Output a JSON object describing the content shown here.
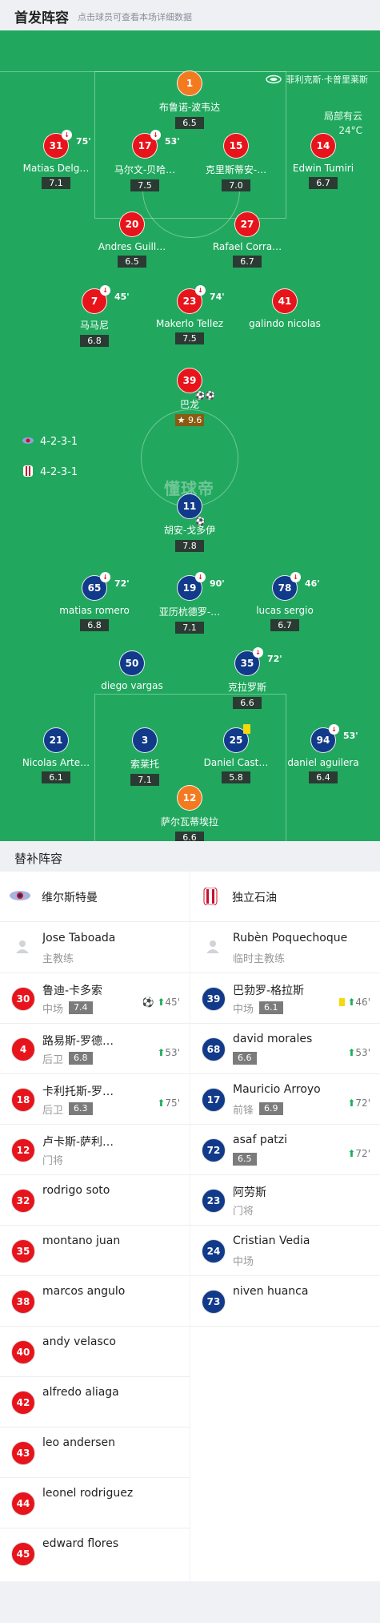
{
  "header": {
    "title": "首发阵容",
    "subtitle": "点击球员可查看本场详细数据"
  },
  "pitch": {
    "venue": "菲利克斯·卡普里莱斯",
    "weather": "局部有云",
    "temperature": "24°C",
    "watermark": "懂球帝",
    "home_formation": "4-2-3-1",
    "away_formation": "4-2-3-1",
    "home_players": [
      {
        "number": "1",
        "name": "布鲁诺-波韦达",
        "rating": "6.5"
      },
      {
        "number": "31",
        "name": "Matias Delg…",
        "rating": "7.1",
        "sub_min": "75'"
      },
      {
        "number": "17",
        "name": "马尔文-贝哈…",
        "rating": "7.5",
        "sub_min": "53'"
      },
      {
        "number": "15",
        "name": "克里斯蒂安-…",
        "rating": "7.0"
      },
      {
        "number": "14",
        "name": "Edwin Tumiri",
        "rating": "6.7"
      },
      {
        "number": "20",
        "name": "Andres Guill…",
        "rating": "6.5"
      },
      {
        "number": "27",
        "name": "Rafael Corra…",
        "rating": "6.7"
      },
      {
        "number": "7",
        "name": "马马尼",
        "rating": "6.8",
        "sub_min": "45'"
      },
      {
        "number": "23",
        "name": "Makerlo Tellez",
        "rating": "7.5",
        "sub_min": "74'"
      },
      {
        "number": "41",
        "name": "galindo nicolas",
        "rating": ""
      },
      {
        "number": "39",
        "name": "巴龙",
        "rating": "9.6"
      }
    ],
    "away_players": [
      {
        "number": "11",
        "name": "胡安-戈多伊",
        "rating": "7.8"
      },
      {
        "number": "65",
        "name": "matias romero",
        "rating": "6.8",
        "sub_min": "72'"
      },
      {
        "number": "19",
        "name": "亚历杭德罗-…",
        "rating": "7.1",
        "sub_min": "90'"
      },
      {
        "number": "78",
        "name": "lucas sergio",
        "rating": "6.7",
        "sub_min": "46'"
      },
      {
        "number": "50",
        "name": "diego vargas",
        "rating": ""
      },
      {
        "number": "35",
        "name": "克拉罗斯",
        "rating": "6.6",
        "sub_min": "72'"
      },
      {
        "number": "21",
        "name": "Nicolas Arte…",
        "rating": "6.1"
      },
      {
        "number": "3",
        "name": "索莱托",
        "rating": "7.1"
      },
      {
        "number": "25",
        "name": "Daniel Cast…",
        "rating": "5.8"
      },
      {
        "number": "94",
        "name": "daniel aguilera",
        "rating": "6.4",
        "sub_min": "53'"
      },
      {
        "number": "12",
        "name": "萨尔瓦蒂埃拉",
        "rating": "6.6"
      }
    ]
  },
  "subs": {
    "title": "替补阵容",
    "home": {
      "team": "维尔斯特曼",
      "coach": {
        "name": "Jose Taboada",
        "role": "主教练"
      },
      "players": [
        {
          "number": "30",
          "name": "鲁迪-卡多索",
          "pos": "中场",
          "rating": "7.4",
          "event": "45'"
        },
        {
          "number": "4",
          "name": "路易斯-罗德…",
          "pos": "后卫",
          "rating": "6.8",
          "event": "53'"
        },
        {
          "number": "18",
          "name": "卡利托斯-罗…",
          "pos": "后卫",
          "rating": "6.3",
          "event": "75'"
        },
        {
          "number": "12",
          "name": "卢卡斯-萨利…",
          "pos": "门将"
        },
        {
          "number": "32",
          "name": "rodrigo soto"
        },
        {
          "number": "35",
          "name": "montano juan"
        },
        {
          "number": "38",
          "name": "marcos angulo"
        },
        {
          "number": "40",
          "name": "andy velasco"
        },
        {
          "number": "42",
          "name": "alfredo aliaga"
        },
        {
          "number": "43",
          "name": "leo andersen"
        },
        {
          "number": "44",
          "name": "leonel rodriguez"
        },
        {
          "number": "45",
          "name": "edward flores"
        }
      ]
    },
    "away": {
      "team": "独立石油",
      "coach": {
        "name": "Rubèn Poquechoque",
        "role": "临时主教练"
      },
      "players": [
        {
          "number": "39",
          "name": "巴勃罗-格拉斯",
          "pos": "中场",
          "rating": "6.1",
          "event": "46'"
        },
        {
          "number": "68",
          "name": "david morales",
          "pos": "",
          "rating": "6.6",
          "event": "53'"
        },
        {
          "number": "17",
          "name": "Mauricio Arroyo",
          "pos": "前锋",
          "rating": "6.9",
          "event": "72'"
        },
        {
          "number": "72",
          "name": "asaf patzi",
          "pos": "",
          "rating": "6.5",
          "event": "72'"
        },
        {
          "number": "23",
          "name": "阿劳斯",
          "pos": "门将"
        },
        {
          "number": "24",
          "name": "Cristian Vedia",
          "pos": "中场"
        },
        {
          "number": "73",
          "name": "niven huanca"
        }
      ]
    }
  },
  "colors": {
    "pitch": "#21a85e",
    "home": "#e8141b",
    "away": "#123a8a",
    "goalkeeper": "#f47a20"
  }
}
